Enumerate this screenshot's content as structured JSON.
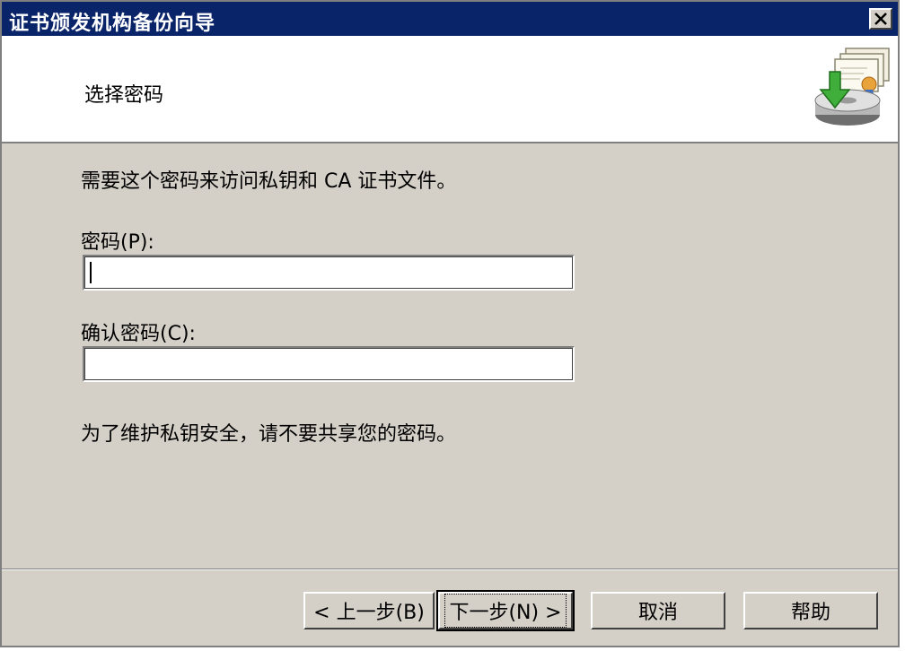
{
  "window": {
    "title": "证书颁发机构备份向导",
    "close_label": "✕"
  },
  "header": {
    "title": "选择密码",
    "icon": "certificate-backup-icon"
  },
  "content": {
    "description": "需要这个密码来访问私钥和 CA 证书文件。",
    "password_label": "密码(P):",
    "password_value": "",
    "confirm_label": "确认密码(C):",
    "confirm_value": "",
    "notice": "为了维护私钥安全，请不要共享您的密码。"
  },
  "buttons": {
    "back": "< 上一步(B)",
    "next": "下一步(N) >",
    "cancel": "取消",
    "help": "帮助"
  },
  "colors": {
    "titlebar": "#0a246a",
    "dialog_bg": "#d4d0c8"
  }
}
